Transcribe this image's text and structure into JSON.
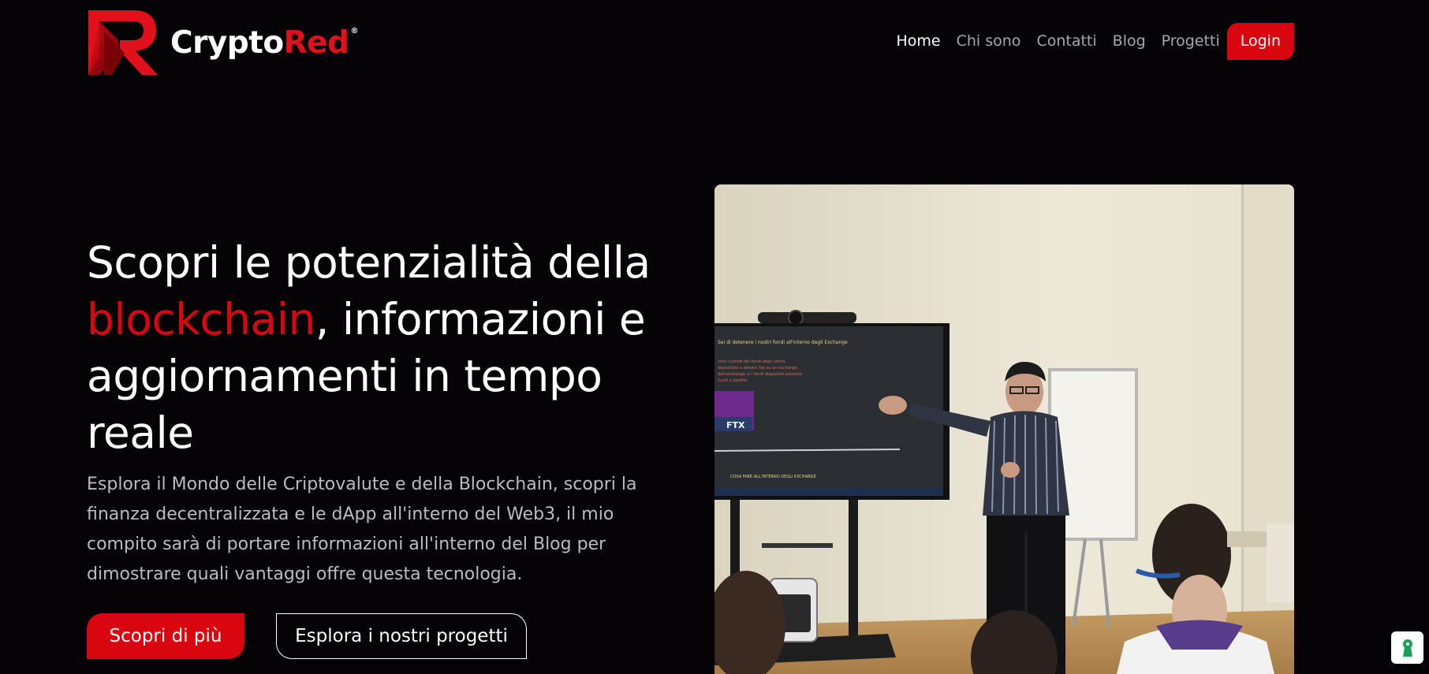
{
  "brand": {
    "name_part1": "Crypto",
    "name_part2": "Red",
    "registered": "®"
  },
  "nav": {
    "items": [
      {
        "label": "Home",
        "active": true
      },
      {
        "label": "Chi sono",
        "active": false
      },
      {
        "label": "Contatti",
        "active": false
      },
      {
        "label": "Blog",
        "active": false
      },
      {
        "label": "Progetti",
        "active": false
      }
    ],
    "login_label": "Login"
  },
  "hero": {
    "title_part1": "Scopri le potenzialità della ",
    "title_accent": "blockchain",
    "title_part2": ", informazioni e aggiornamenti in tempo reale",
    "description": "Esplora il Mondo delle Criptovalute e della Blockchain, scopri la finanza decentralizzata e le dApp all'interno del Web3, il mio compito sarà di portare informazioni all'interno del Blog per dimostrare quali vantaggi offre questa tecnologia.",
    "primary_button": "Scopri di più",
    "secondary_button": "Esplora i nostri progetti"
  },
  "photo": {
    "screen_title": "Sei di detenere i nostri fondi all'interno degli Exchange",
    "screen_line1": "sono custodi dei fondi degli utenti.",
    "screen_line2": "depositate e denaro fiat su un exchange,",
    "screen_line3": "dall'exchange, e i fondi depositati possono",
    "screen_line4": "rischi e perdite.",
    "screen_logo": "FTX",
    "screen_footer": "COSA FARE ALL'INTERNO DEGLI EXCHANGE"
  },
  "colors": {
    "accent": "#d9060f",
    "background": "#050305",
    "nav_inactive": "#a7a7a7",
    "body_text": "#bcbcbc"
  },
  "icons": {
    "widget": "privacy-keyhole-icon"
  }
}
